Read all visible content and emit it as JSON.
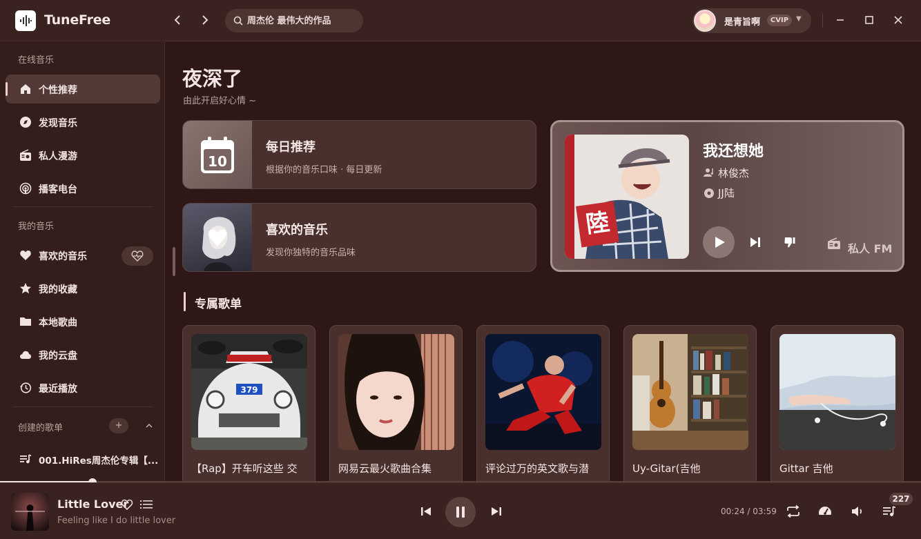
{
  "app": {
    "name": "TuneFree"
  },
  "search": {
    "placeholder": "周杰伦 最伟大的作品"
  },
  "user": {
    "name": "是青旨啊",
    "vip": "CVIP"
  },
  "sidebar": {
    "section_online": "在线音乐",
    "section_mine": "我的音乐",
    "section_created": "创建的歌单",
    "online_items": [
      {
        "label": "个性推荐",
        "icon": "home-icon",
        "active": true
      },
      {
        "label": "发现音乐",
        "icon": "disc-icon"
      },
      {
        "label": "私人漫游",
        "icon": "radio-icon"
      },
      {
        "label": "播客电台",
        "icon": "podcast-icon"
      }
    ],
    "mine_items": [
      {
        "label": "喜欢的音乐",
        "icon": "heart-icon"
      },
      {
        "label": "我的收藏",
        "icon": "star-icon"
      },
      {
        "label": "本地歌曲",
        "icon": "folder-icon"
      },
      {
        "label": "我的云盘",
        "icon": "cloud-icon"
      },
      {
        "label": "最近播放",
        "icon": "history-icon"
      }
    ],
    "created_items": [
      {
        "label": "001.HiRes周杰伦专辑【...",
        "icon": "playlist-icon"
      }
    ],
    "add_button": "+",
    "collapse_button": "^"
  },
  "main": {
    "greeting": "夜深了",
    "greeting_sub": "由此开启好心情 ~",
    "daily": {
      "title": "每日推荐",
      "subtitle": "根据你的音乐口味 · 每日更新",
      "date": "10"
    },
    "liked": {
      "title": "喜欢的音乐",
      "subtitle": "发现你独特的音乐品味"
    },
    "fm": {
      "song": "我还想她",
      "artist": "林俊杰",
      "album": "JJ陆",
      "label": "私人 FM",
      "album_art_text": "陸"
    },
    "section_title": "专属歌单",
    "playlists": [
      {
        "name": "【Rap】开车听这些 交"
      },
      {
        "name": "网易云最火歌曲合集"
      },
      {
        "name": "评论过万的英文歌与潜"
      },
      {
        "name": "Uy-Gitar(吉他"
      },
      {
        "name": "Gittar 吉他"
      }
    ]
  },
  "player": {
    "song": "Little Lover",
    "lyric": "Feeling like I do little lover",
    "current_time": "00:24",
    "total_time": "03:59",
    "time_sep": " / ",
    "queue_count": "227",
    "progress": 0.1
  },
  "colors": {
    "bg": "#2d1817",
    "panel": "#4a302d",
    "accent": "#f0d0cc"
  }
}
